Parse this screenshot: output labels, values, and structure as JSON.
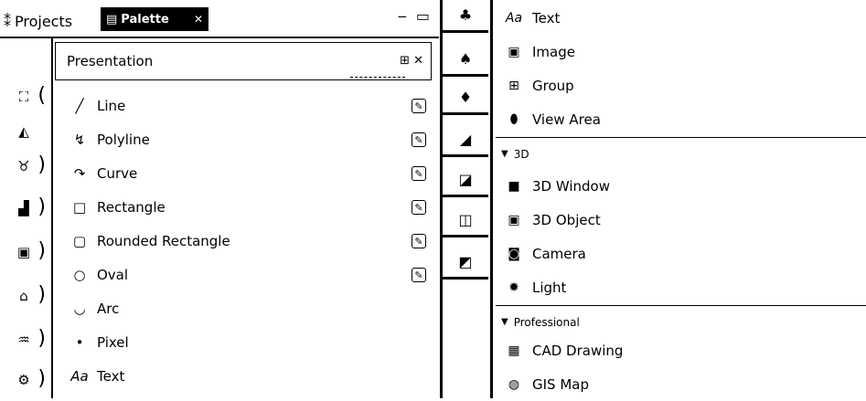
{
  "view_tabs": {
    "projects_label": "Projects",
    "palette_label": "Palette"
  },
  "drawer": {
    "title": "Presentation",
    "tools": [
      {
        "label": "Line",
        "icon": "line-icon",
        "glyph": "╱",
        "editable": true
      },
      {
        "label": "Polyline",
        "icon": "polyline-icon",
        "glyph": "↯",
        "editable": true
      },
      {
        "label": "Curve",
        "icon": "curve-icon",
        "glyph": "↷",
        "editable": true
      },
      {
        "label": "Rectangle",
        "icon": "rectangle-icon",
        "glyph": "□",
        "editable": true
      },
      {
        "label": "Rounded Rectangle",
        "icon": "rounded-rectangle-icon",
        "glyph": "▢",
        "editable": true
      },
      {
        "label": "Oval",
        "icon": "oval-icon",
        "glyph": "○",
        "editable": true
      },
      {
        "label": "Arc",
        "icon": "arc-icon",
        "glyph": "◡",
        "editable": false
      },
      {
        "label": "Pixel",
        "icon": "pixel-icon",
        "glyph": "•",
        "editable": false
      },
      {
        "label": "Text",
        "icon": "text-icon",
        "glyph": "Aa",
        "editable": false
      }
    ]
  },
  "right_palette": {
    "items_top": [
      {
        "label": "Text",
        "icon": "text-icon",
        "glyph": "Aa"
      },
      {
        "label": "Image",
        "icon": "image-icon",
        "glyph": "▣"
      },
      {
        "label": "Group",
        "icon": "group-icon",
        "glyph": "⊞"
      },
      {
        "label": "View Area",
        "icon": "view-area-icon",
        "glyph": "⬮"
      }
    ],
    "section_3d": "3D",
    "items_3d": [
      {
        "label": "3D Window",
        "icon": "3d-window-icon",
        "glyph": "■"
      },
      {
        "label": "3D Object",
        "icon": "3d-object-icon",
        "glyph": "▣"
      },
      {
        "label": "Camera",
        "icon": "camera-icon",
        "glyph": "◙"
      },
      {
        "label": "Light",
        "icon": "light-icon",
        "glyph": "✹"
      }
    ],
    "section_professional": "Professional",
    "items_professional": [
      {
        "label": "CAD Drawing",
        "icon": "cad-drawing-icon",
        "glyph": "▦"
      },
      {
        "label": "GIS Map",
        "icon": "gis-map-icon",
        "glyph": "◍"
      }
    ]
  }
}
